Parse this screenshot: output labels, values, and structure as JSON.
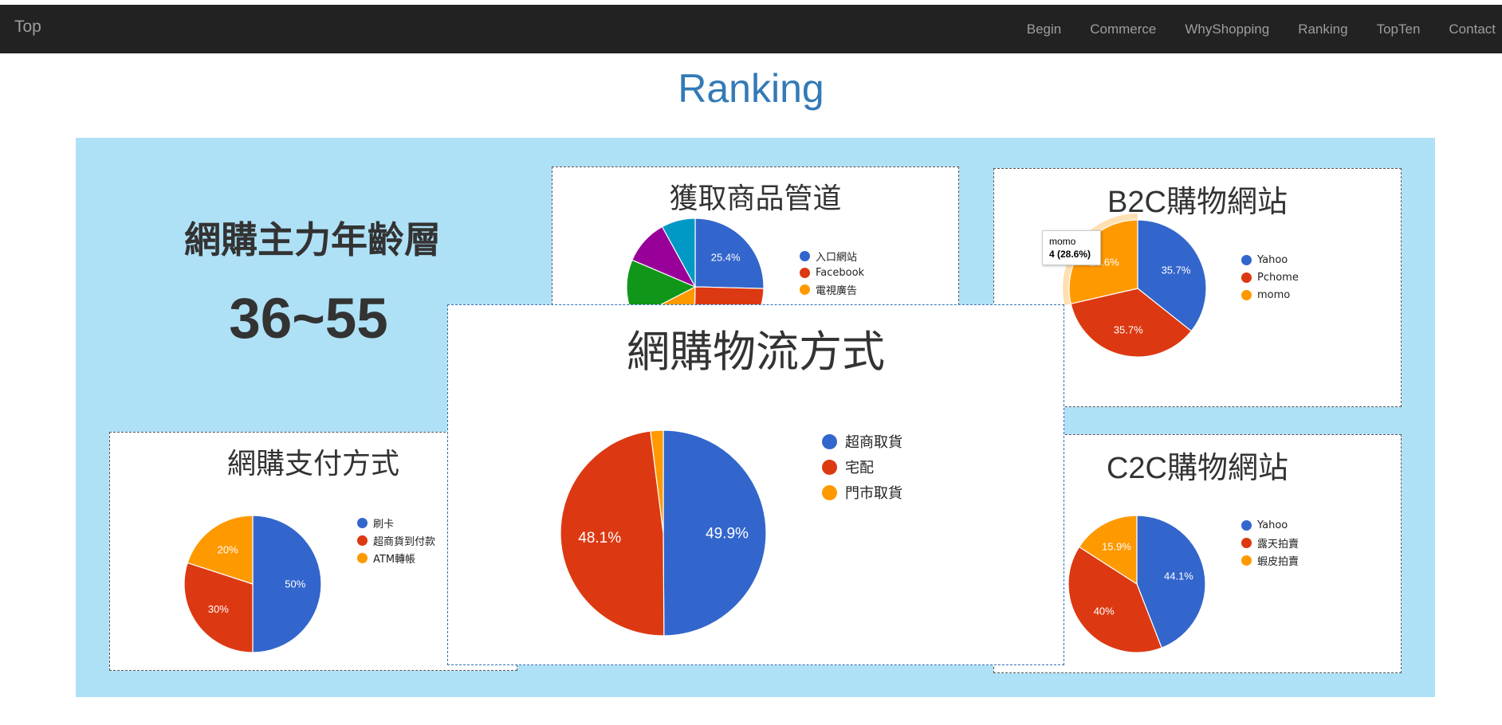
{
  "navbar": {
    "brand": "Top",
    "links": [
      "Begin",
      "Commerce",
      "WhyShopping",
      "Ranking",
      "TopTen",
      "Contact"
    ]
  },
  "page_title": "Ranking",
  "age_block": {
    "title": "網購主力年齡層",
    "value": "36~55"
  },
  "tooltip": {
    "label": "momo",
    "value": "4 (28.6%)"
  },
  "chart_data": [
    {
      "id": "channel",
      "type": "pie",
      "title": "獲取商品管道",
      "categories": [
        "入口網站",
        "Facebook",
        "電視廣告"
      ],
      "colors": [
        "#3366cc",
        "#dc3912",
        "#ff9900",
        "#109618",
        "#990099",
        "#0099c6"
      ],
      "slices": [
        {
          "value": 25.4,
          "label": "25.4%"
        },
        {
          "value": 25.0,
          "label": ""
        },
        {
          "value": 17.0,
          "label": ""
        },
        {
          "value": 14.0,
          "label": ""
        },
        {
          "value": 10.6,
          "label": ""
        },
        {
          "value": 8.0,
          "label": ""
        }
      ]
    },
    {
      "id": "b2c",
      "type": "pie",
      "title": "B2C購物網站",
      "categories": [
        "Yahoo",
        "Pchome",
        "momo"
      ],
      "colors": [
        "#3366cc",
        "#dc3912",
        "#ff9900"
      ],
      "slices": [
        {
          "value": 35.7,
          "label": "35.7%"
        },
        {
          "value": 35.7,
          "label": "35.7%"
        },
        {
          "value": 28.6,
          "label": "28.6%"
        }
      ]
    },
    {
      "id": "payment",
      "type": "pie",
      "title": "網購支付方式",
      "categories": [
        "刷卡",
        "超商貨到付款",
        "ATM轉帳"
      ],
      "colors": [
        "#3366cc",
        "#dc3912",
        "#ff9900"
      ],
      "slices": [
        {
          "value": 50,
          "label": "50%"
        },
        {
          "value": 30,
          "label": "30%"
        },
        {
          "value": 20,
          "label": "20%"
        }
      ]
    },
    {
      "id": "c2c",
      "type": "pie",
      "title": "C2C購物網站",
      "categories": [
        "Yahoo",
        "露天拍賣",
        "蝦皮拍賣"
      ],
      "colors": [
        "#3366cc",
        "#dc3912",
        "#ff9900"
      ],
      "slices": [
        {
          "value": 44.1,
          "label": "44.1%"
        },
        {
          "value": 40.0,
          "label": "40%"
        },
        {
          "value": 15.9,
          "label": "15.9%"
        }
      ]
    },
    {
      "id": "logistics",
      "type": "pie",
      "title": "網購物流方式",
      "categories": [
        "超商取貨",
        "宅配",
        "門市取貨"
      ],
      "colors": [
        "#3366cc",
        "#dc3912",
        "#ff9900"
      ],
      "slices": [
        {
          "value": 49.9,
          "label": "49.9%"
        },
        {
          "value": 48.1,
          "label": "48.1%"
        },
        {
          "value": 2.0,
          "label": ""
        }
      ]
    }
  ]
}
